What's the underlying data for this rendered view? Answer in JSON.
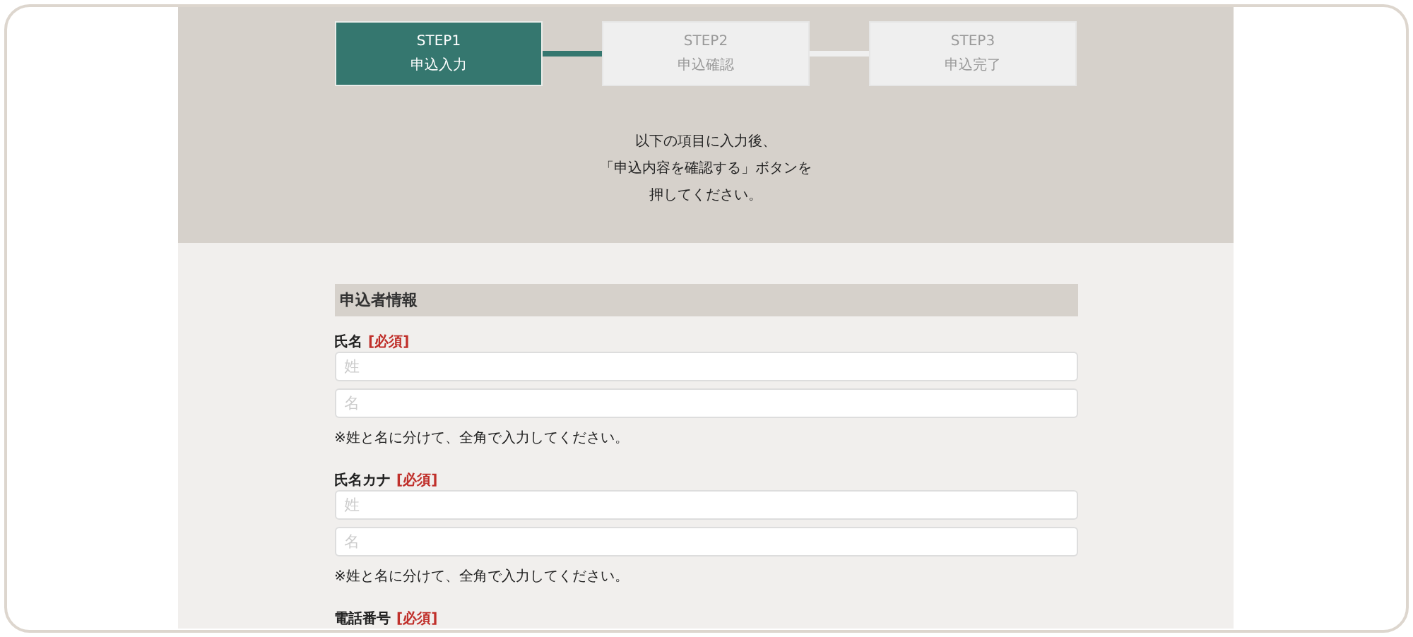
{
  "steps": [
    {
      "label": "STEP1",
      "title": "申込入力",
      "selected": true
    },
    {
      "label": "STEP2",
      "title": "申込確認",
      "selected": false
    },
    {
      "label": "STEP3",
      "title": "申込完了",
      "selected": false
    }
  ],
  "instructions": [
    "以下の項目に入力後、",
    "「申込内容を確認する」ボタンを",
    "押してください。"
  ],
  "section": {
    "title": "申込者情報"
  },
  "fields": [
    {
      "label": "氏名",
      "required": "[必須]",
      "inputs": [
        {
          "placeholder": "姓"
        },
        {
          "placeholder": "名"
        }
      ],
      "note": "※姓と名に分けて、全角で入力してください。"
    },
    {
      "label": "氏名カナ",
      "required": "[必須]",
      "inputs": [
        {
          "placeholder": "姓"
        },
        {
          "placeholder": "名"
        }
      ],
      "note": "※姓と名に分けて、全角で入力してください。"
    },
    {
      "label": "電話番号",
      "required": "[必須]"
    }
  ]
}
